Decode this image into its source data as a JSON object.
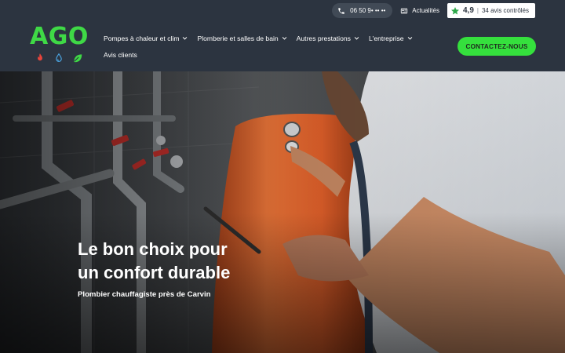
{
  "topbar": {
    "phone": "06 50 9• •• ••",
    "news_label": "Actualités",
    "rating_score": "4,9",
    "rating_text": "34 avis contrôlés"
  },
  "logo": {
    "text": "AGO",
    "icons": [
      "flame-icon",
      "water-drop-icon",
      "leaf-icon"
    ]
  },
  "nav": {
    "row1": [
      {
        "label": "Pompes à chaleur et clim",
        "dropdown": true
      },
      {
        "label": "Plomberie et salles de bain",
        "dropdown": true
      },
      {
        "label": "Autres prestations",
        "dropdown": true
      },
      {
        "label": "L'entreprise",
        "dropdown": true
      }
    ],
    "row2": [
      {
        "label": "Avis clients",
        "dropdown": false
      }
    ]
  },
  "cta": {
    "label": "CONTACTEZ-NOUS"
  },
  "hero": {
    "title_line1": "Le bon choix pour",
    "title_line2": "un confort durable",
    "subtitle": "Plombier chauffagiste près de Carvin"
  },
  "colors": {
    "header_bg": "#2c3440",
    "accent_green": "#35e03d",
    "logo_green": "#3fd946",
    "tank_orange": "#e8642a"
  }
}
